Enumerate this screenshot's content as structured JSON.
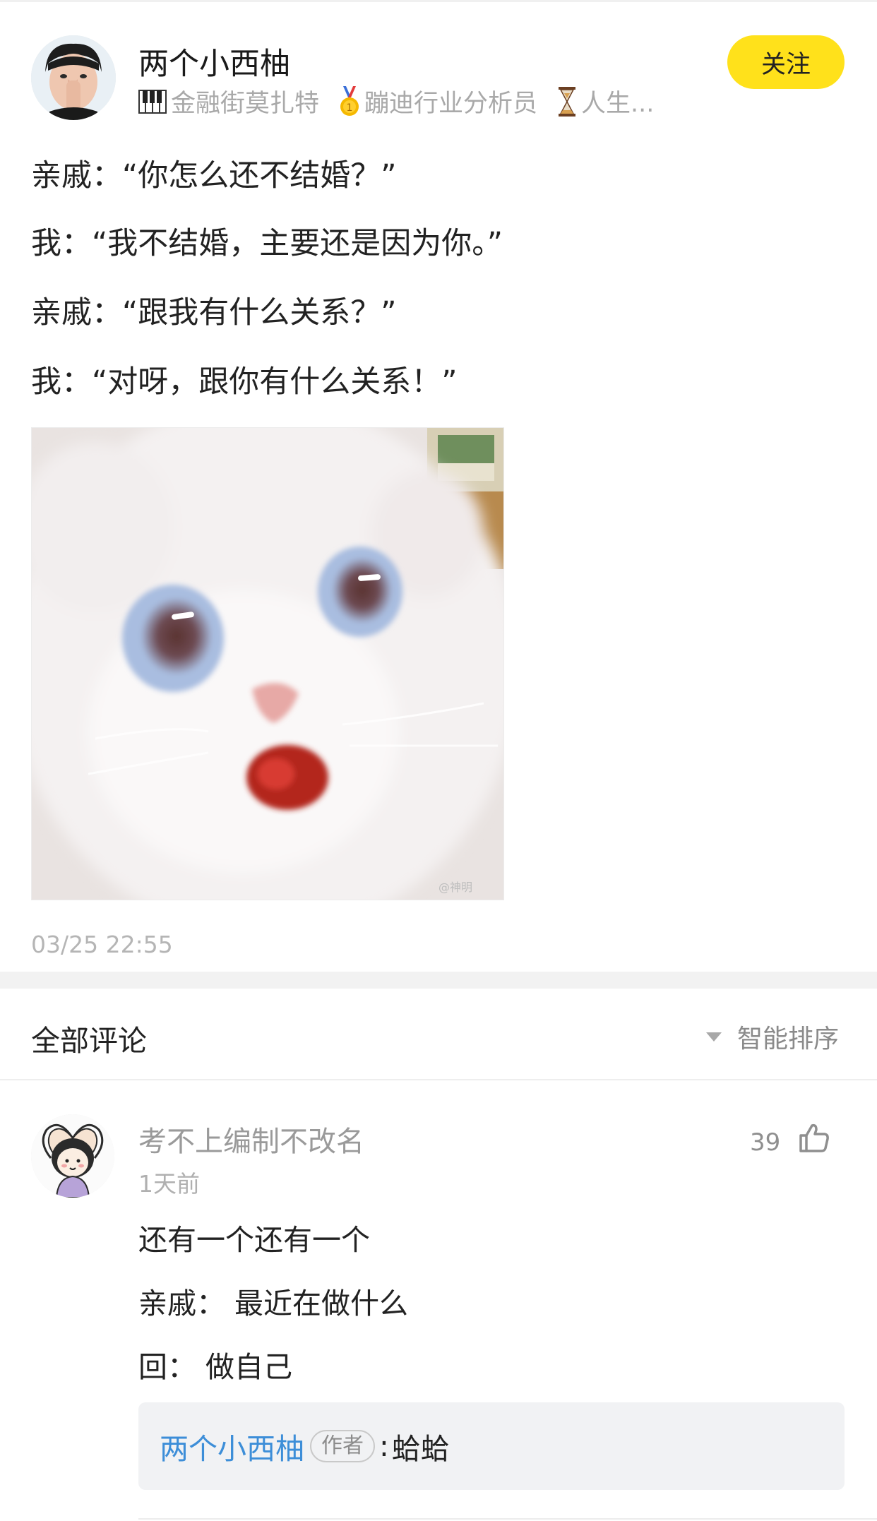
{
  "post": {
    "author": "两个小西柚",
    "badges": [
      {
        "icon": "piano-icon",
        "label": "金融街莫扎特"
      },
      {
        "icon": "medal-icon",
        "label": "蹦迪行业分析员"
      },
      {
        "icon": "hourglass-icon",
        "label": "人生..."
      }
    ],
    "follow_label": "关注",
    "lines": [
      "亲戚：“你怎么还不结婚？”",
      "我：“我不结婚，主要还是因为你。”",
      "亲戚：“跟我有什么关系？”",
      "我：“对呀，跟你有什么关系！”"
    ],
    "image_watermark": "@神明",
    "time": "03/25 22:55"
  },
  "comments_header": {
    "title": "全部评论",
    "sort_label": "智能排序"
  },
  "comment": {
    "author": "考不上编制不改名",
    "time": "1天前",
    "likes": "39",
    "lines": [
      "还有一个还有一个",
      "亲戚：  最近在做什么",
      "回：  做自己"
    ],
    "reply": {
      "name": "两个小西柚",
      "tag": "作者",
      "colon": ":",
      "text": "蛤蛤"
    }
  },
  "colors": {
    "follow_button": "#ffe11b",
    "reply_name": "#3d8ed8",
    "reply_box_bg": "#f1f2f4"
  }
}
